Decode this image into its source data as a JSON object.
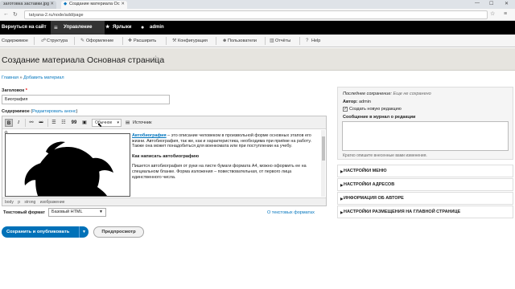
{
  "browser": {
    "tabs": [
      {
        "title": "заготовка заставки.jpg"
      },
      {
        "title": "Создание материала Ос"
      }
    ],
    "url": "tatyana-2.ru/node/add/page"
  },
  "admin_toolbar": {
    "back": "Вернуться на сайт",
    "manage": "Управление",
    "shortcuts": "Ярлыки",
    "user": "admin"
  },
  "admin_menu": [
    "Содержимое",
    "Структура",
    "Оформление",
    "Расширить",
    "Конфигурация",
    "Пользователи",
    "Отчёты",
    "Help"
  ],
  "page": {
    "title": "Создание материала Основная страница",
    "breadcrumb": [
      "Главная",
      "Добавить материал"
    ]
  },
  "form": {
    "title_label": "Заголовок",
    "required_mark": "*",
    "title_value": "Биография",
    "body_label": "Содержимое",
    "body_label_link": "Редактировать анонс",
    "editor": {
      "bold": "B",
      "italic": "I",
      "quote": "99",
      "format_select": "Обычное",
      "source": "Источник",
      "text": {
        "p1_link": "Автобиография",
        "p1_rest": " – это описание человеком в произвольной форме основных этапов его жизни. Автобиография, так же, как и характеристика, необходима при приёме на работу. Также она может понадобиться для военкомата или при поступлении на учебу.",
        "h": "Как написать автобиографию",
        "p2": "Пишется автобиография от руки на листе бумаги формата А4, можно оформить ее на специальном бланке. Форма изложения – повествовательная, от первого лица единственного числа."
      },
      "path": [
        "body",
        "p",
        "strong",
        "изображение"
      ]
    },
    "text_format_label": "Текстовый формат",
    "text_format_value": "Базовый HTML",
    "text_format_help": "О текстовых форматах",
    "save_button": "Сохранить и опубликовать",
    "preview_button": "Предпросмотр"
  },
  "sidebar": {
    "last_saved_label": "Последнее сохранение:",
    "last_saved_value": "Еще не сохранено",
    "author_label": "Автор:",
    "author_value": "admin",
    "new_revision": "Создать новую редакцию",
    "log_label": "Сообщение в журнал о редакции",
    "log_hint": "Кратко опишите внесенные вами изменения.",
    "sections": [
      "НАСТРОЙКИ МЕНЮ",
      "НАСТРОЙКИ АДРЕСОВ",
      "ИНФОРМАЦИЯ ОБ АВТОРЕ",
      "НАСТРОЙКИ РАЗМЕЩЕНИЯ НА ГЛАВНОЙ СТРАНИЦЕ"
    ]
  },
  "colors": {
    "link": "#0074bd",
    "primary_button": "#0071b8",
    "admin_bar": "#000000"
  }
}
